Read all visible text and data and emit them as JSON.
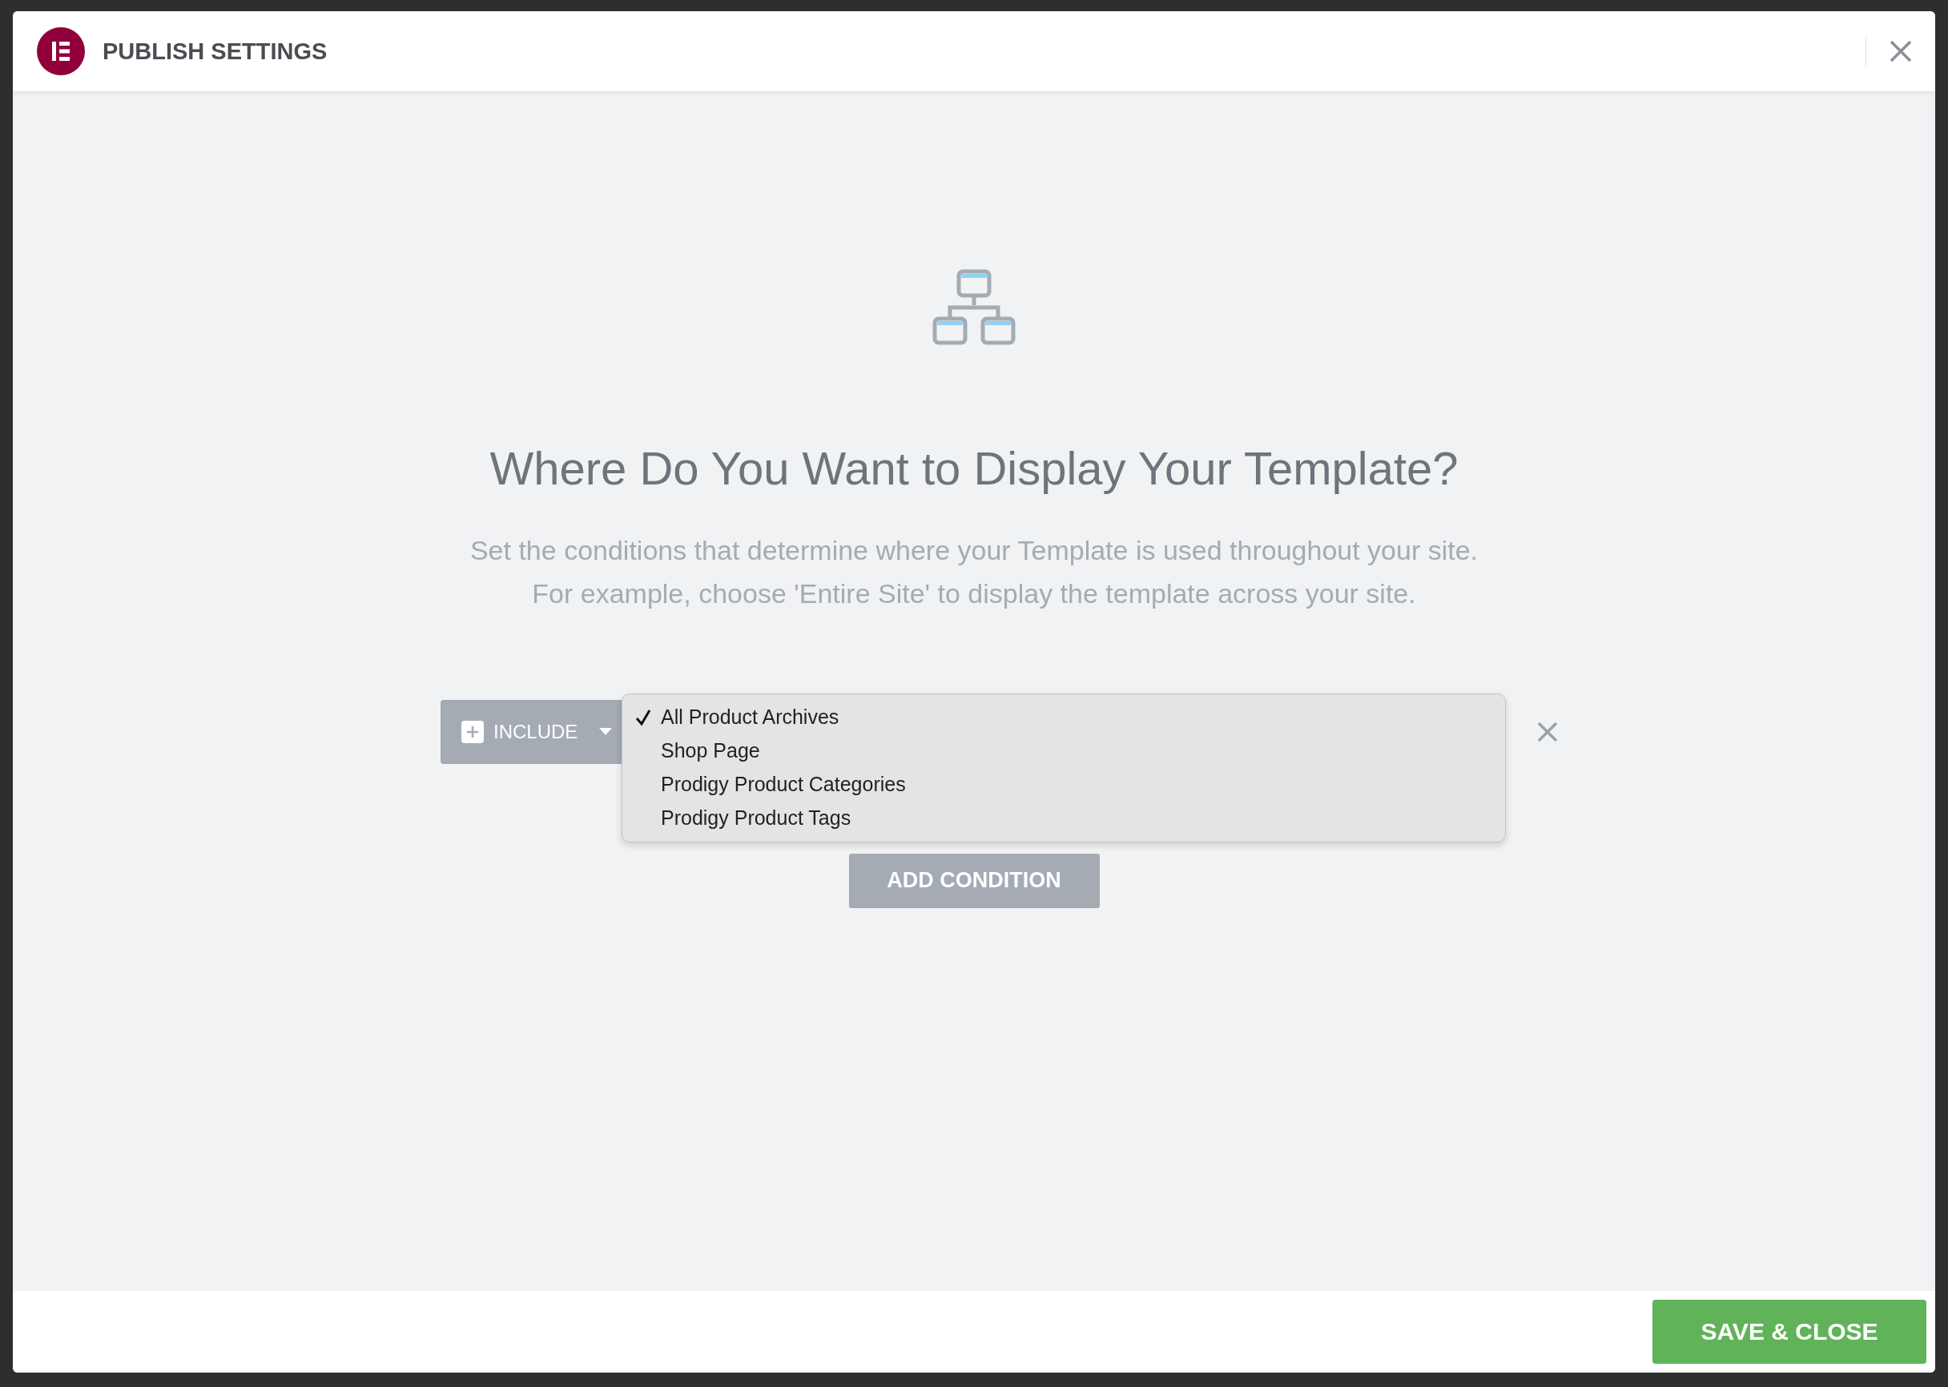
{
  "dialog": {
    "title": "PUBLISH SETTINGS"
  },
  "intro": {
    "heading": "Where Do You Want to Display Your Template?",
    "description_lines": [
      "Set the conditions that determine where your Template is used throughout your site.",
      "For example, choose 'Entire Site' to display the template across your site."
    ]
  },
  "condition": {
    "type_label": "INCLUDE",
    "options": [
      {
        "label": "All Product Archives",
        "selected": true
      },
      {
        "label": "Shop Page",
        "selected": false
      },
      {
        "label": "Prodigy Product Categories",
        "selected": false
      },
      {
        "label": "Prodigy Product Tags",
        "selected": false
      }
    ]
  },
  "add_condition_button": "ADD CONDITION",
  "footer": {
    "save_button": "SAVE & CLOSE"
  }
}
